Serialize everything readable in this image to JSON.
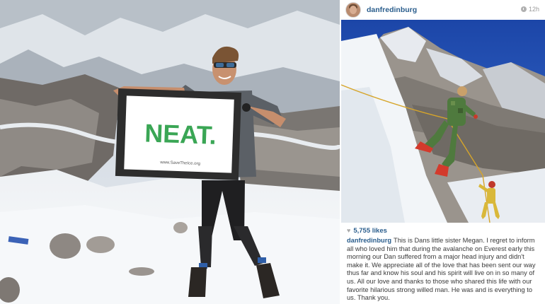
{
  "left_photo": {
    "flag_text": "NEAT.",
    "flag_url": "www.SaveTheIce.org"
  },
  "post": {
    "username": "danfredinburg",
    "time": "12h",
    "likes": "5,755 likes",
    "caption_user": "danfredinburg",
    "caption_text": "This is Dans little sister Megan. I regret to inform all who loved him that during the avalanche on Everest early this morning our Dan suffered from a major head injury and didn't make it. We appreciate all of the love that has been sent our way thus far and know his soul and his spirit will live on in so many of us. All our love and thanks to those who shared this life with our favorite hilarious strong willed man. He was and is everything to us. Thank you."
  },
  "icons": {
    "clock": "clock-icon",
    "heart": "heart-icon",
    "comment": "comment-icon"
  },
  "colors": {
    "link_blue": "#2a5d8c",
    "flag_green": "#3aa655",
    "sky_blue": "#1e4fae"
  }
}
